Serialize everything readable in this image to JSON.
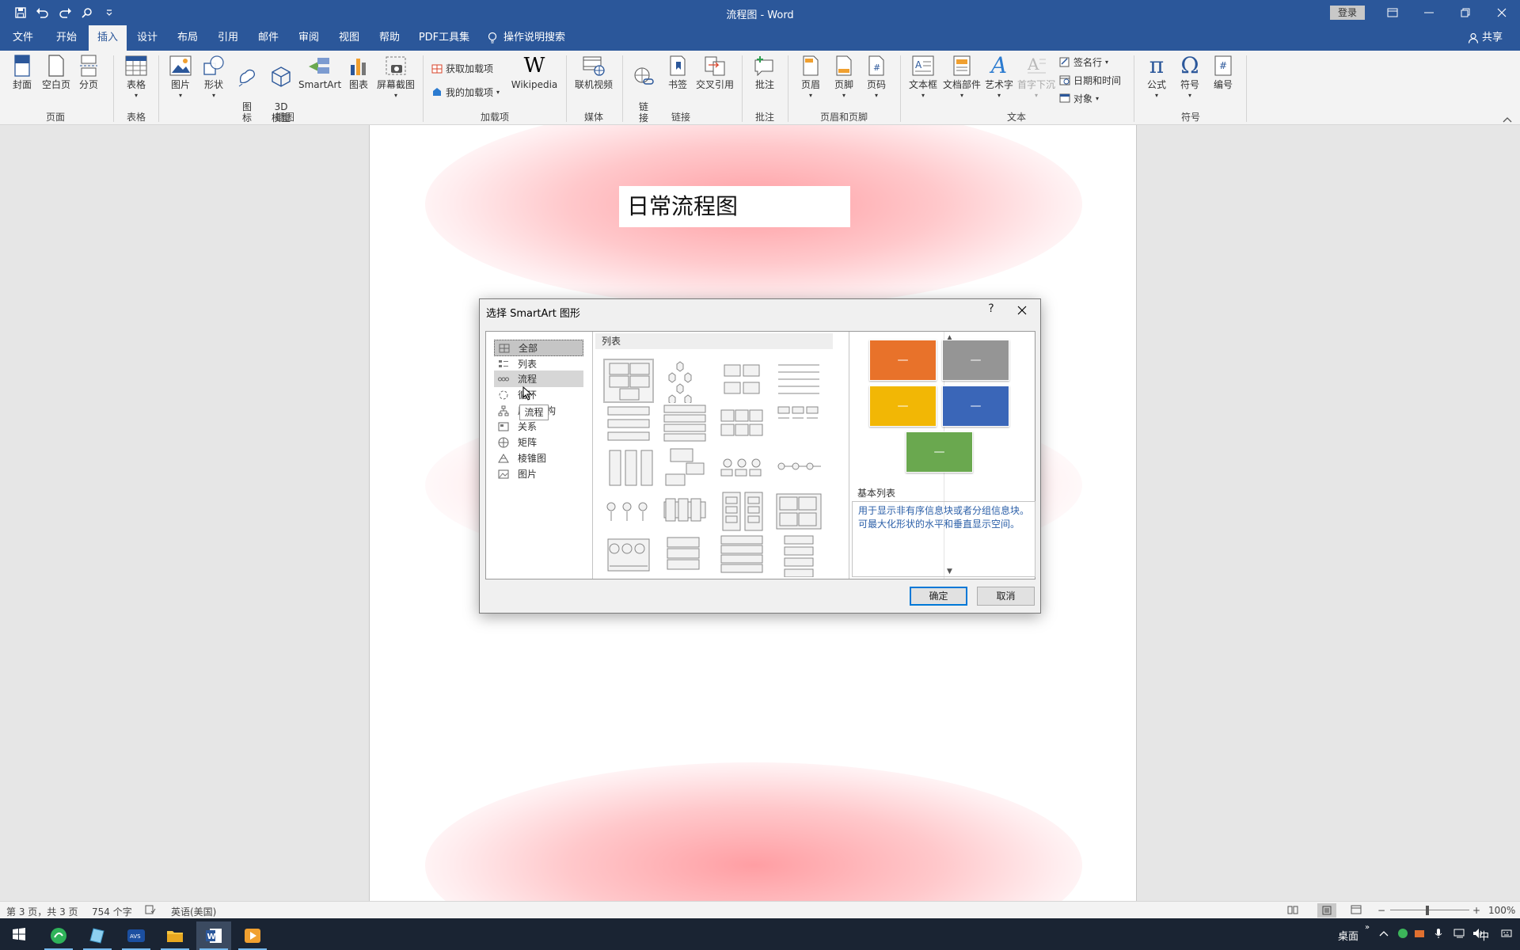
{
  "titlebar": {
    "title": "流程图 - Word",
    "login": "登录"
  },
  "tabs": [
    "文件",
    "开始",
    "插入",
    "设计",
    "布局",
    "引用",
    "邮件",
    "审阅",
    "视图",
    "帮助",
    "PDF工具集"
  ],
  "active_tab": "插入",
  "tell_me": "操作说明搜索",
  "share": "共享",
  "ribbon": {
    "pages": {
      "cover": "封面",
      "blank": "空白页",
      "break": "分页",
      "group": "页面"
    },
    "tables": {
      "table": "表格",
      "group": "表格"
    },
    "illustrations": {
      "picture": "图片",
      "shapes": "形状",
      "icons": "图\n标",
      "model3d": "3D\n模型",
      "smartart": "SmartArt",
      "chart": "图表",
      "screenshot": "屏幕截图",
      "group": "插图"
    },
    "addins": {
      "get": "获取加载项",
      "my": "我的加载项",
      "wikipedia": "Wikipedia",
      "group": "加载项"
    },
    "media": {
      "video": "联机视频",
      "group": "媒体"
    },
    "links": {
      "link": "链\n接",
      "bookmark": "书签",
      "crossref": "交叉引用",
      "group": "链接"
    },
    "comments": {
      "comment": "批注",
      "group": "批注"
    },
    "headerfooter": {
      "header": "页眉",
      "footer": "页脚",
      "pagenum": "页码",
      "group": "页眉和页脚"
    },
    "text": {
      "textbox": "文本框",
      "quickparts": "文档部件",
      "wordart": "艺术字",
      "dropcap": "首字下沉",
      "signature": "签名行",
      "datetime": "日期和时间",
      "object": "对象",
      "group": "文本"
    },
    "symbols": {
      "equation": "公式",
      "symbol": "符号",
      "number": "编号",
      "group": "符号"
    }
  },
  "document": {
    "heading": "日常流程图"
  },
  "dialog": {
    "title": "选择 SmartArt 图形",
    "help": "?",
    "categories": [
      "全部",
      "列表",
      "流程",
      "循环",
      "层次结构",
      "关系",
      "矩阵",
      "棱锥图",
      "图片"
    ],
    "selected_category": "全部",
    "hover_category": "流程",
    "tooltip": "流程",
    "pane_header": "列表",
    "preview_name": "基本列表",
    "preview_desc": "用于显示非有序信息块或者分组信息块。可最大化形状的水平和垂直显示空间。",
    "preview_colors": [
      "#e8722a",
      "#959595",
      "#f2b705",
      "#3a66b8",
      "#6aa84f"
    ],
    "ok": "确定",
    "cancel": "取消"
  },
  "status": {
    "page": "第 3 页，共 3 页",
    "words": "754 个字",
    "lang": "英语(美国)",
    "zoom": "100%"
  },
  "taskbar": {
    "desktop": "桌面",
    "ime": "中"
  }
}
